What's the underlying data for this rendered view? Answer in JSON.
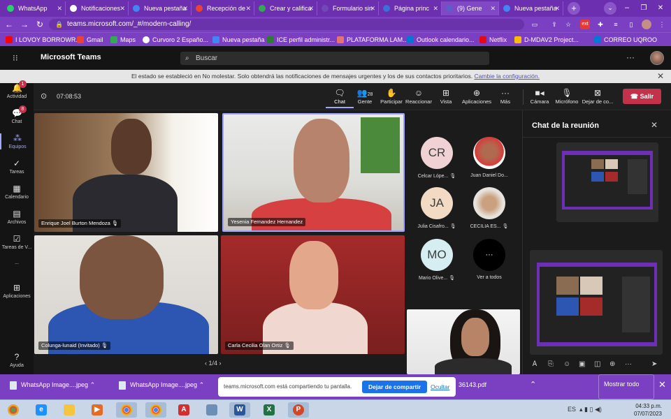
{
  "browser": {
    "tabs": [
      {
        "label": "WhatsApp"
      },
      {
        "label": "Notificaciones"
      },
      {
        "label": "Nueva pestaña"
      },
      {
        "label": "Recepción de"
      },
      {
        "label": "Crear y califica"
      },
      {
        "label": "Formulario sin"
      },
      {
        "label": "Página princ"
      },
      {
        "label": "(9) Gene"
      },
      {
        "label": "Nueva pestaña"
      }
    ],
    "url": "teams.microsoft.com/_#/modern-calling/",
    "bookmarks": [
      {
        "label": "I LOVOY BORROWR..."
      },
      {
        "label": "Gmail"
      },
      {
        "label": "Maps"
      },
      {
        "label": "Curvoro 2 Españo..."
      },
      {
        "label": "Nueva pestaña"
      },
      {
        "label": "ICE perfil administr..."
      },
      {
        "label": "PLATAFORMA LAM..."
      },
      {
        "label": "Outlook calendario..."
      },
      {
        "label": "Netflix"
      },
      {
        "label": "D-MDAV2 Project..."
      },
      {
        "label": "CORREO UQROO"
      }
    ],
    "colors": {
      "chrome": "#7b3fc2",
      "tab_strip": "#6b2fb0"
    }
  },
  "teams": {
    "title": "Microsoft Teams",
    "search_placeholder": "Buscar",
    "notice_text": "El estado se estableció en No molestar. Solo obtendrá las notificaciones de mensajes urgentes y los de sus contactos prioritarios.",
    "notice_link": "Cambie la configuración.",
    "rail": [
      {
        "label": "Actividad",
        "badge": "1"
      },
      {
        "label": "Chat",
        "badge": "8"
      },
      {
        "label": "Equipos",
        "badge": ""
      },
      {
        "label": "Tareas",
        "badge": ""
      },
      {
        "label": "Calendario",
        "badge": ""
      },
      {
        "label": "Archivos",
        "badge": ""
      },
      {
        "label": "Tareas de V...",
        "badge": ""
      },
      {
        "label": "...",
        "badge": ""
      },
      {
        "label": "Aplicaciones",
        "badge": ""
      },
      {
        "label": "Ayuda",
        "badge": ""
      }
    ],
    "timer": "07:08:53",
    "toolbar": {
      "chat": "Chat",
      "people": "Gente",
      "people_count": "28",
      "raise": "Participar",
      "react": "Reaccionar",
      "view": "Vista",
      "apps": "Aplicaciones",
      "more": "Más",
      "camera": "Cámara",
      "mic": "Micrófono",
      "share": "Dejar de co...",
      "leave": "Salir"
    },
    "participants_video": [
      {
        "name": "Enrique Joel Burton Mendoza"
      },
      {
        "name": "Yesenia Fernandez Hernandez"
      },
      {
        "name": "Colunga-lunaid (Invitado)"
      },
      {
        "name": "Carla Cecilia Olan Ortiz"
      }
    ],
    "participants_grid": [
      {
        "initials": "CR",
        "name": "Celcar Lópe..."
      },
      {
        "initials": "",
        "name": "Juan Daniel Do..."
      },
      {
        "initials": "JA",
        "name": "Julia Cisafro..."
      },
      {
        "initials": "",
        "name": "CECILIA ES..."
      },
      {
        "initials": "MO",
        "name": "Mario Olive..."
      },
      {
        "initials": "···",
        "name": "Ver a todos"
      }
    ],
    "pager": "1/4",
    "chat_panel_title": "Chat de la reunión"
  },
  "downloads": {
    "items": [
      {
        "label": "WhatsApp Image....jpeg"
      },
      {
        "label": "WhatsApp Image....jpeg"
      },
      {
        "label": "36143.pdf"
      }
    ],
    "share_text": "teams.microsoft.com está compartiendo tu pantalla.",
    "stop_share": "Dejar de compartir",
    "hide": "Ocultar",
    "show_all": "Mostrar todo"
  },
  "taskbar": {
    "time": "04:33 p.m.",
    "date": "07/07/2023",
    "lang": "ES"
  }
}
